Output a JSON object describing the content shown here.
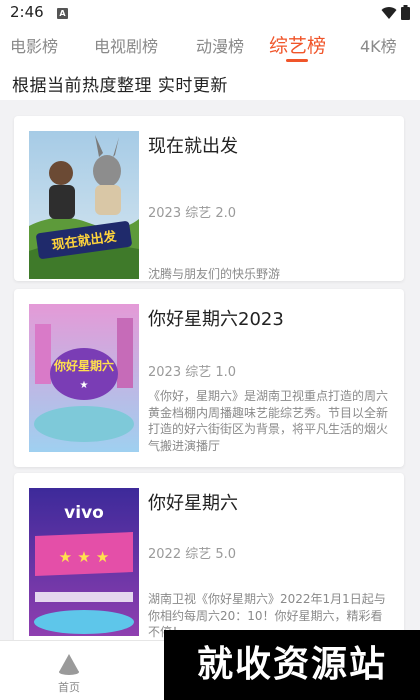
{
  "status_bar": {
    "time": "2:46",
    "notification_icon": "A",
    "wifi_icon": "wifi-icon",
    "battery_icon": "battery-icon"
  },
  "tabs": [
    {
      "label": "电影榜",
      "active": false
    },
    {
      "label": "电视剧榜",
      "active": false
    },
    {
      "label": "动漫榜",
      "active": false
    },
    {
      "label": "综艺榜",
      "active": true
    },
    {
      "label": "4K榜",
      "active": false
    }
  ],
  "subtitle": "根据当前热度整理 实时更新",
  "items": [
    {
      "title": "现在就出发",
      "meta": "2023 综艺 2.0",
      "desc": "沈腾与朋友们的快乐野游",
      "poster_text": "现在就出发"
    },
    {
      "title": "你好星期六2023",
      "meta": "2023 综艺 1.0",
      "desc": "《你好，星期六》是湖南卫视重点打造的周六黄金档棚内周播趣味艺能综艺秀。节目以全新打造的好六街街区为背景，将平凡生活的烟火气搬进演播厅",
      "poster_text": "你好星期六"
    },
    {
      "title": "你好星期六",
      "meta": "2022 综艺 5.0",
      "desc": "湖南卫视《你好星期六》2022年1月1日起与你相约每周六20：10！你好星期六，精彩看不停！",
      "poster_text": "vivo"
    }
  ],
  "bottom_nav": {
    "home_label": "首页"
  },
  "watermark": "就收资源站",
  "colors": {
    "accent": "#f0552a"
  }
}
